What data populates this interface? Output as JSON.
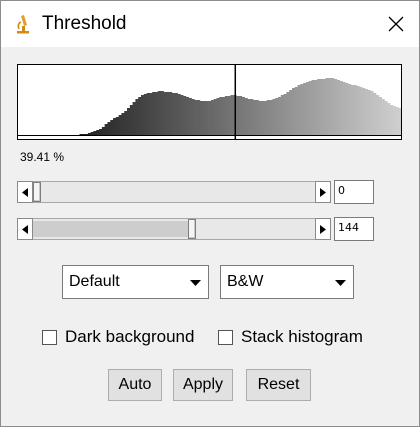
{
  "window": {
    "title": "Threshold",
    "icon": "microscope-icon",
    "close_icon": "close-icon"
  },
  "histogram": {
    "threshold_min": 0,
    "threshold_max": 144,
    "bins": [
      0,
      0,
      0,
      0,
      0,
      0,
      0,
      0,
      0,
      0,
      0,
      0,
      0,
      0,
      0,
      0,
      0,
      0,
      0,
      0,
      0,
      0,
      1,
      1,
      1,
      2,
      3,
      4,
      5,
      6,
      8,
      11,
      13,
      15,
      17,
      18,
      20,
      22,
      24,
      27,
      30,
      33,
      36,
      38,
      40,
      41,
      42,
      42,
      43,
      43,
      44,
      44,
      43,
      43,
      43,
      42,
      42,
      41,
      40,
      39,
      38,
      37,
      36,
      35,
      35,
      34,
      34,
      34,
      34,
      35,
      36,
      37,
      38,
      38,
      39,
      39,
      40,
      40,
      39,
      39,
      38,
      37,
      36,
      36,
      35,
      35,
      34,
      34,
      34,
      35,
      35,
      36,
      37,
      38,
      40,
      41,
      43,
      45,
      47,
      48,
      50,
      51,
      52,
      53,
      54,
      55,
      55,
      56,
      56,
      56,
      57,
      57,
      57,
      56,
      55,
      54,
      53,
      52,
      51,
      50,
      50,
      49,
      48,
      47,
      46,
      45,
      44,
      42,
      40,
      38,
      36,
      34,
      32,
      30,
      29,
      28,
      27
    ],
    "bin_max": 60
  },
  "percent_label": "39.41 %",
  "sliders": {
    "min": {
      "value": 0,
      "range_max": 255
    },
    "max": {
      "value": 144,
      "range_max": 255
    }
  },
  "fields": {
    "min_value": "0",
    "max_value": "144"
  },
  "method_select": {
    "value": "Default"
  },
  "mode_select": {
    "value": "B&W"
  },
  "checkboxes": {
    "dark_background": {
      "label": "Dark background",
      "checked": false
    },
    "stack_histogram": {
      "label": "Stack histogram",
      "checked": false
    }
  },
  "buttons": {
    "auto": "Auto",
    "apply": "Apply",
    "reset": "Reset"
  }
}
